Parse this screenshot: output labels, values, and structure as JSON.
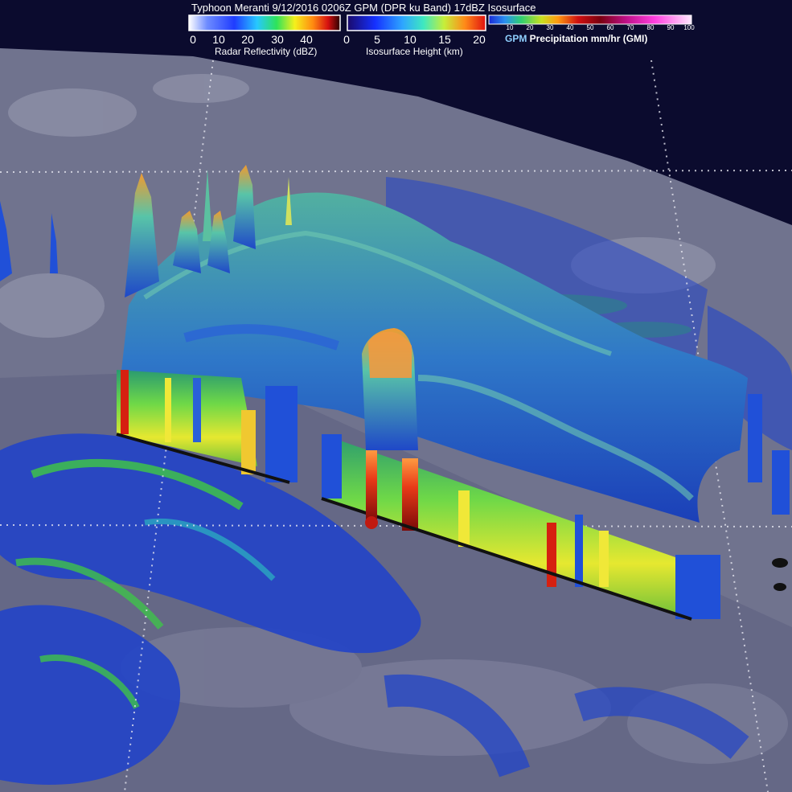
{
  "title": "Typhoon Meranti 9/12/2016 0206Z GPM (DPR ku Band) 17dBZ Isosurface",
  "legend_reflectivity": {
    "label": "Radar Reflectivity (dBZ)",
    "ticks": [
      "0",
      "10",
      "20",
      "30",
      "40"
    ]
  },
  "legend_height": {
    "label": "Isosurface Height (km)",
    "ticks": [
      "0",
      "5",
      "10",
      "15",
      "20"
    ]
  },
  "legend_precip": {
    "label_brand": "GPM",
    "label_rest": " Precipitation mm/hr (GMI)",
    "ticks": [
      "10",
      "20",
      "30",
      "40",
      "50",
      "60",
      "70",
      "80",
      "90",
      "100"
    ]
  },
  "colors": {
    "background": "#0b0b2e",
    "surface_gray": "#7b7e98",
    "rain_blue": "#2244c8",
    "rain_green": "#3ec24a",
    "isosurface_teal": "#3fa8a0",
    "hot_red": "#c81a10"
  }
}
